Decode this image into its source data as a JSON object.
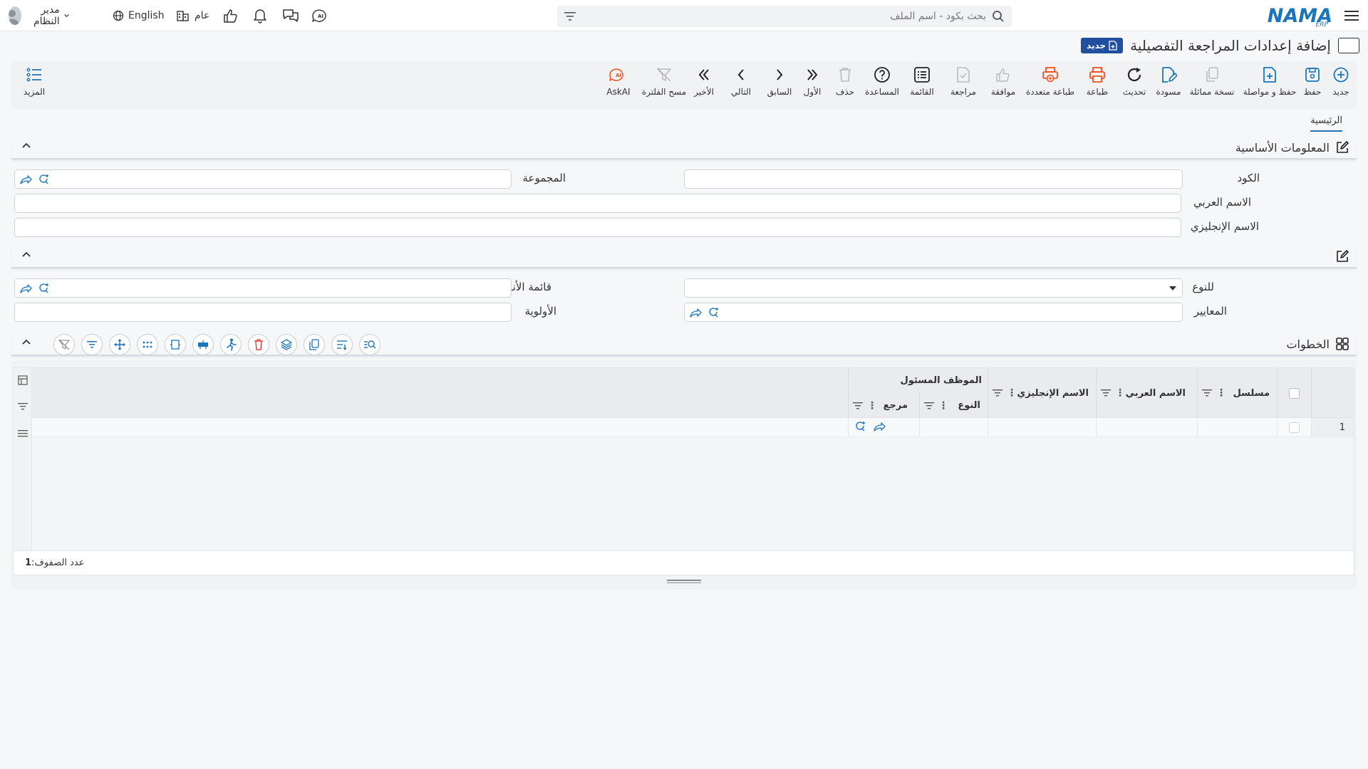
{
  "topbar": {
    "search_placeholder": "بحث بكود - اسم الملف",
    "logo_text": "NAMA",
    "logo_sub": "ERP",
    "user_name": "مدير النظام",
    "language": "English",
    "branch": "عام"
  },
  "page": {
    "title": "إضافة إعدادات المراجعة التفصيلية",
    "new_badge": "جديد"
  },
  "toolbar": {
    "new": "جديد",
    "save": "حفظ",
    "save_continue": "حفظ و مواصلة",
    "duplicate": "نسخة مماثلة",
    "draft": "مسودة",
    "refresh": "تحديث",
    "print": "طباعة",
    "multi_print": "طباعة متعددة",
    "approve": "موافقة",
    "review": "مراجعة",
    "list": "القائمة",
    "help": "المساعدة",
    "delete": "حذف",
    "first": "الأول",
    "previous": "السابق",
    "next": "التالي",
    "last": "الأخير",
    "clear_filter": "مسح الفلترة",
    "askai": "AskAI",
    "more": "المزيد"
  },
  "tabs": {
    "main": "الرئيسية"
  },
  "basic_info": {
    "title": "المعلومات الأساسية",
    "code_label": "الكود",
    "group_label": "المجموعة",
    "arabic_name_label": "الاسم العربي",
    "english_name_label": "الاسم الإنجليزي"
  },
  "section2": {
    "for_type_label": "للنوع",
    "types_list_label": "قائمة الأنواع",
    "criteria_label": "المعايير",
    "priority_label": "الأولوية"
  },
  "steps": {
    "title": "الخطوات",
    "columns": {
      "serial": "مسلسل",
      "arabic_name": "الاسم العربي",
      "english_name": "الاسم الإنجليزي",
      "responsible_employee": "الموظف المسئول",
      "type": "النوع",
      "reference": "مرجع"
    },
    "rows": [
      {
        "num": "1"
      }
    ],
    "row_count_label": "عدد الصفوف:",
    "row_count": "1"
  }
}
